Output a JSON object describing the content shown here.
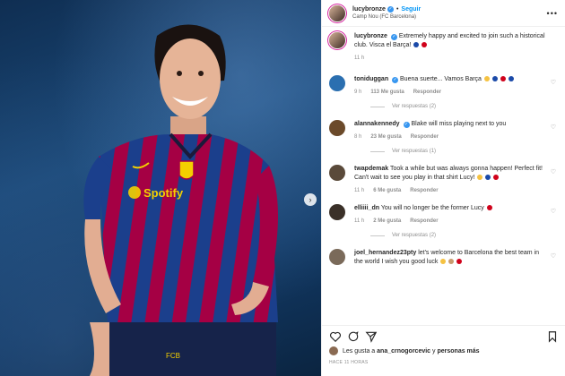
{
  "header": {
    "username": "lucybronze",
    "separator": "•",
    "follow_label": "Seguir",
    "location": "Camp Nou (FC Barcelona)",
    "more_icon": "more-options-icon"
  },
  "caption": {
    "username": "lucybronze",
    "text": "Extremely happy and excited to join such a historical club. Visca el Barça!",
    "time": "11 h"
  },
  "comments": [
    {
      "username": "toniduggan",
      "verified": true,
      "text": "Buena suerte... Vamos Barça",
      "time": "9 h",
      "likes": "113 Me gusta",
      "reply": "Responder",
      "replies": "Ver respuestas (2)",
      "avatar_color": "#2b6fb0"
    },
    {
      "username": "alannakennedy",
      "verified": true,
      "text": "Blake will miss playing next to you",
      "time": "8 h",
      "likes": "23 Me gusta",
      "reply": "Responder",
      "replies": "Ver respuestas (1)",
      "avatar_color": "#6b4a2a"
    },
    {
      "username": "twapdemak",
      "verified": false,
      "text": "Took a while but was always gonna happen! Perfect fit! Can't wait to see you play in that shirt Lucy!",
      "time": "11 h",
      "likes": "6 Me gusta",
      "reply": "Responder",
      "replies": "",
      "avatar_color": "#5a4a3a"
    },
    {
      "username": "elliiii_dn",
      "verified": false,
      "text": "You will no longer be the former Lucy",
      "time": "11 h",
      "likes": "2 Me gusta",
      "reply": "Responder",
      "replies": "Ver respuestas (2)",
      "avatar_color": "#3a3028"
    },
    {
      "username": "joel_hernandez23pty",
      "verified": false,
      "text": "let's welcome to Barcelona the best team in the world I wish you good luck",
      "time": "",
      "likes": "",
      "reply": "",
      "replies": "",
      "avatar_color": "#7a6a5a"
    }
  ],
  "footer": {
    "likes_prefix": "Les gusta a",
    "likes_user": "ana_crnogorcevic",
    "likes_middle": "y",
    "likes_others": "personas más",
    "timestamp": "HACE 11 HORAS"
  },
  "colors": {
    "blaugrana_blue": "#1b4aa8",
    "blaugrana_red": "#a50044",
    "link_blue": "#0095f6",
    "verified_blue": "#3897f0"
  }
}
